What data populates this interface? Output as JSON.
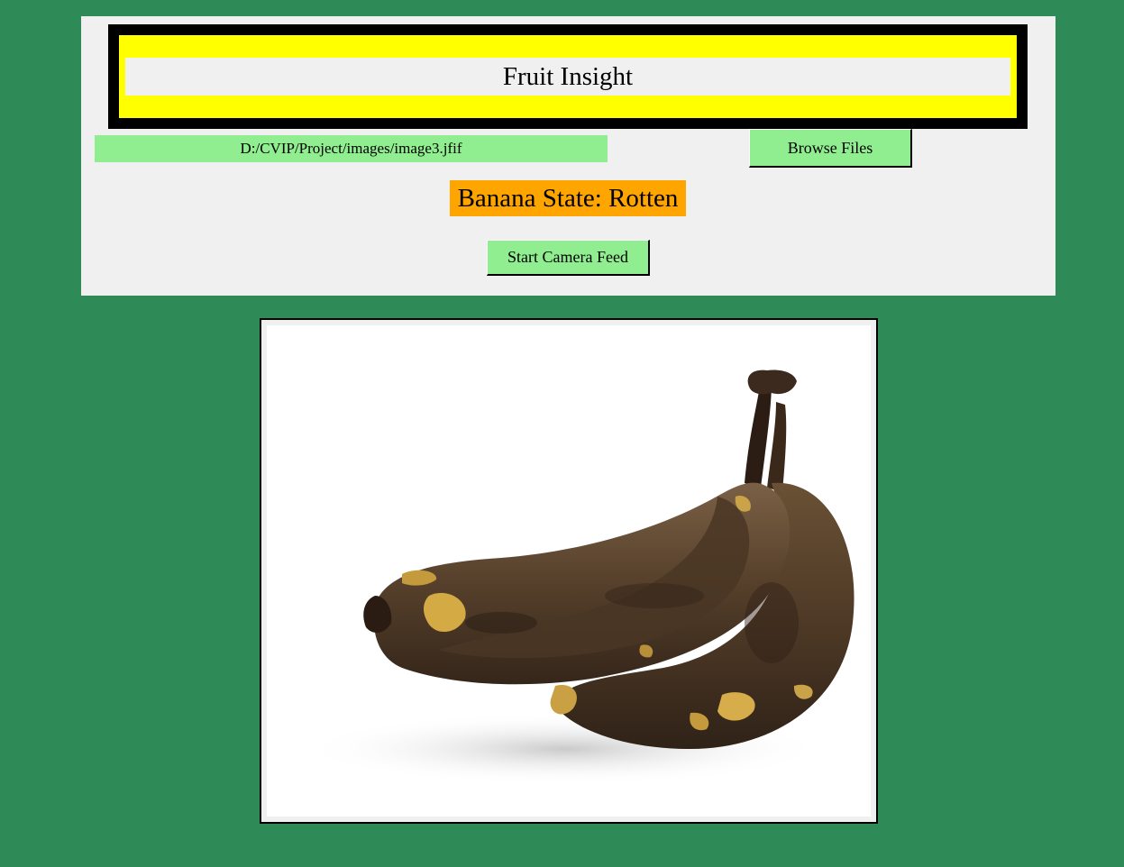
{
  "app": {
    "title": "Fruit Insight"
  },
  "file_picker": {
    "path_value": "D:/CVIP/Project/images/image3.jfif",
    "browse_label": "Browse Files"
  },
  "result": {
    "status_text": "Banana State: Rotten"
  },
  "camera": {
    "start_label": "Start Camera Feed"
  },
  "preview": {
    "subject": "rotten-banana-bunch-photo"
  },
  "colors": {
    "window_background": "#2e8b57",
    "panel_background": "#f0f0f0",
    "title_border": "#000000",
    "title_highlight": "#ffff00",
    "field_and_button": "#90ee90",
    "status_background": "#ffa500"
  }
}
